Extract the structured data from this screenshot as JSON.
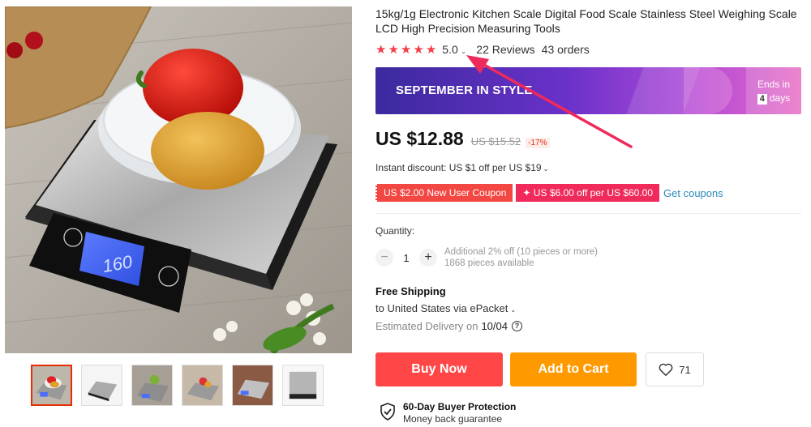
{
  "product": {
    "title": "15kg/1g Electronic Kitchen Scale Digital Food Scale Stainless Steel Weighing Scale LCD High Precision Measuring Tools",
    "display_reading": "160"
  },
  "rating": {
    "stars": 5,
    "value": "5.0",
    "reviews": "22 Reviews",
    "orders": "43 orders"
  },
  "banner": {
    "text": "SEPTEMBER IN STYLE",
    "ends_label": "Ends in",
    "days_count": "4",
    "days_label": "days"
  },
  "pricing": {
    "price": "US $12.88",
    "old_price": "US $15.52",
    "discount": "-17%",
    "instant_discount": "Instant discount: US $1 off per US $19"
  },
  "coupons": {
    "items": [
      "US $2.00 New User Coupon",
      "✦ US $6.00 off per US $60.00"
    ],
    "get_label": "Get coupons"
  },
  "quantity": {
    "label": "Quantity:",
    "value": "1",
    "minus": "−",
    "plus": "+",
    "note_1": "Additional 2% off (10 pieces or more)",
    "note_2": "1868 pieces available"
  },
  "shipping": {
    "title": "Free Shipping",
    "to": "to United States via ePacket",
    "delivery_label": "Estimated Delivery on",
    "delivery_date": "10/04"
  },
  "actions": {
    "buy_now": "Buy Now",
    "add_to_cart": "Add to Cart",
    "wishlist_count": "71"
  },
  "protection": {
    "title": "60-Day Buyer Protection",
    "subtitle": "Money back guarantee"
  },
  "colors": {
    "star": "#f2404b",
    "buy_now": "#ff4747",
    "add_to_cart": "#ff9900",
    "link": "#2b8ab9",
    "annotation_arrow": "#ee2a5c"
  },
  "icons": [
    "star-icon",
    "chevron-down-icon",
    "help-icon",
    "heart-icon",
    "shield-check-icon"
  ]
}
